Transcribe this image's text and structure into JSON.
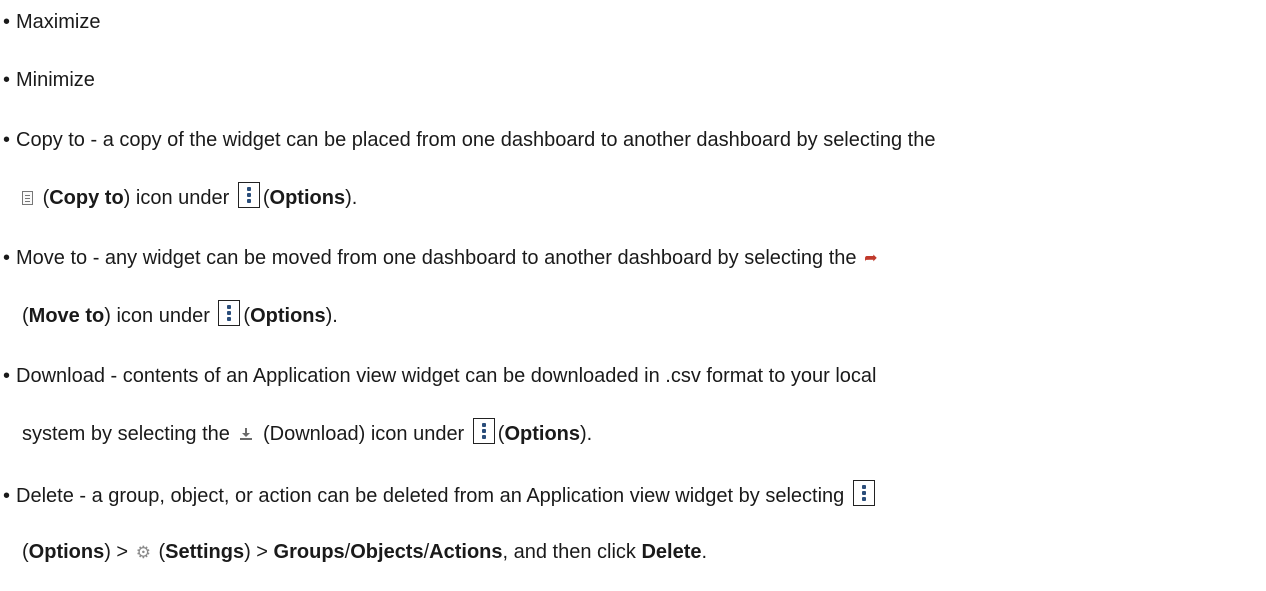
{
  "bullet": "•",
  "items": {
    "maximize": {
      "text": "Maximize"
    },
    "minimize": {
      "text": "Minimize"
    },
    "copy_to": {
      "text_a": "Copy to - a copy of the widget can be placed from one dashboard to another dashboard by selecting the",
      "open_paren": "(",
      "bold_copy": "Copy to",
      "mid": ") icon under",
      "open_paren2": "(",
      "bold_options": "Options",
      "end": ")."
    },
    "move_to": {
      "text_a": "Move to - any widget can be moved from one dashboard to another dashboard by selecting the",
      "open_paren": "(",
      "bold_move": "Move to",
      "mid": ") icon under",
      "open_paren2": "(",
      "bold_options": "Options",
      "end": ")."
    },
    "download": {
      "text_a": "Download - contents of an Application view widget can be downloaded in .csv format to your local",
      "text_b": "system by selecting the",
      "mid": "(Download) icon under",
      "open_paren": "(",
      "bold_options": "Options",
      "end": ")."
    },
    "delete": {
      "text_a": "Delete - a group, object, or action can be deleted from an Application view widget by selecting",
      "open_paren": "(",
      "bold_options": "Options",
      "sep1": ") >",
      "open_paren2": "(",
      "bold_settings": "Settings",
      "sep2": ") >",
      "bold_groups": "Groups",
      "slash1": "/",
      "bold_objects": "Objects",
      "slash2": "/",
      "bold_actions": "Actions",
      "then": ", and then click",
      "bold_delete": "Delete",
      "period": "."
    }
  },
  "icons": {
    "options": "options-kebab-icon",
    "copy": "document-copy-icon",
    "move": "move-arrow-icon",
    "download": "download-icon",
    "settings": "gear-icon"
  },
  "colors": {
    "text": "#1a1a1a",
    "options_dots": "#2a4d7a",
    "move_arrow": "#c0392b",
    "gear": "#8a8a8a"
  }
}
